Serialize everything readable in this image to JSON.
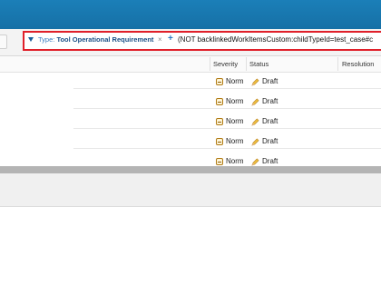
{
  "query": {
    "chip_key": "Type:",
    "chip_value": "Tool Operational Requirement",
    "close_glyph": "×",
    "add_glyph": "+",
    "text": "(NOT backlinkedWorkItemsCustom:childTypeId=test_case#c"
  },
  "columns": {
    "severity": "Severity",
    "status": "Status",
    "resolution": "Resolution"
  },
  "rows": [
    {
      "severity": "Norm",
      "status": "Draft"
    },
    {
      "severity": "Norm",
      "status": "Draft"
    },
    {
      "severity": "Norm",
      "status": "Draft"
    },
    {
      "severity": "Norm",
      "status": "Draft"
    },
    {
      "severity": "Norm",
      "status": "Draft"
    }
  ],
  "colors": {
    "topbar": "#1b7fb8",
    "highlight_outline": "#e0202a",
    "chip_text": "#1a4f86"
  },
  "icons": {
    "severity": "severity-normal-icon",
    "status": "pencil-draft-icon"
  }
}
